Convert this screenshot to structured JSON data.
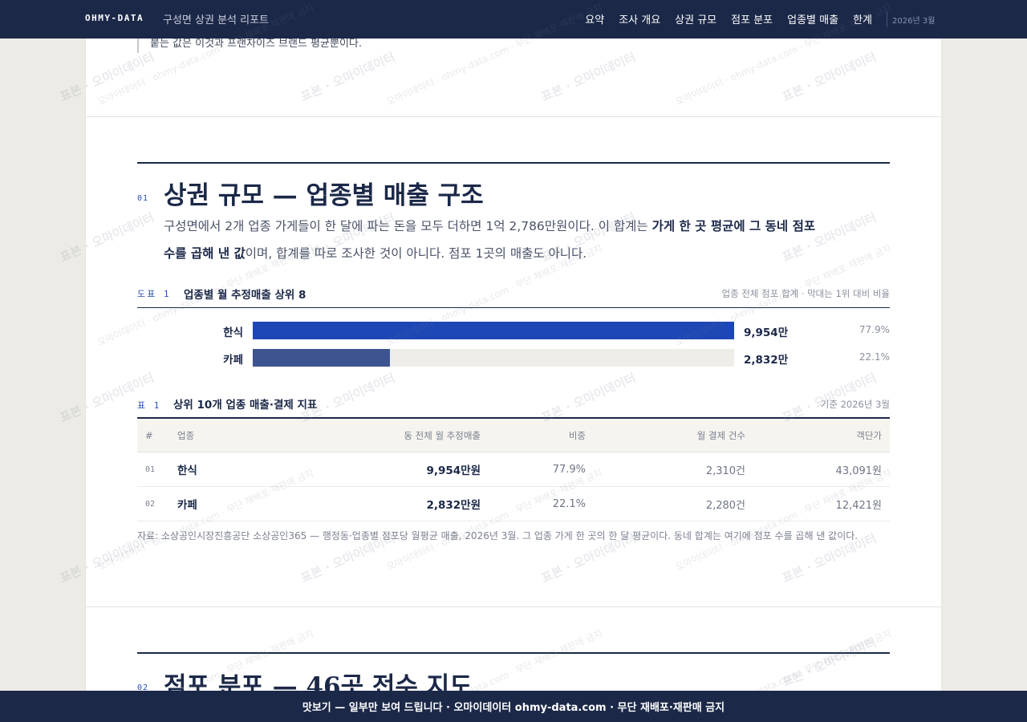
{
  "header": {
    "brand": "OHMY-DATA",
    "report_title": "구성면 상권 분석 리포트",
    "nav": [
      "요약",
      "조사 개요",
      "상권 규모",
      "점포 분포",
      "업종별 매출",
      "한계"
    ],
    "date": "2026년 3월"
  },
  "prev_section": {
    "quote_tail": "붙는 값은 이것과 프랜차이즈 브랜드 평균뿐이다."
  },
  "section1": {
    "number": "01",
    "title": "상권 규모 — 업종별 매출 구조",
    "lead_part1": "구성면에서 2개 업종 가게들이 한 달에 파는 돈을 모두 더하면 1억 2,786만원이다. 이 합계는 ",
    "lead_bold": "가게 한 곳 평균에 그 동네 점포 수를 곱해 낸 값",
    "lead_part2": "이며, 합계를 따로 조사한 것이 아니다. 점포 1곳의 매출도 아니다."
  },
  "figure1": {
    "label": "도표 1",
    "title": "업종별 월 추정매출 상위 8",
    "note": "업종 전체 점포 합계 · 막대는 1위 대비 비율"
  },
  "chart_data": {
    "type": "bar",
    "orientation": "horizontal",
    "title": "업종별 월 추정매출 상위 8",
    "categories": [
      "한식",
      "카페"
    ],
    "values": [
      9954,
      2832
    ],
    "value_labels": [
      "9,954만",
      "2,832만"
    ],
    "share_labels": [
      "77.9%",
      "22.1%"
    ],
    "relative_to_first": [
      1.0,
      0.2845
    ],
    "colors": [
      "#1d47b5",
      "#3d5490"
    ],
    "unit": "만원"
  },
  "table1": {
    "label": "표 1",
    "title": "상위 10개 업종 매출·결제 지표",
    "note": "기준 2026년 3월",
    "columns": [
      "#",
      "업종",
      "동 전체 월 추정매출",
      "비중",
      "월 결제 건수",
      "객단가"
    ],
    "rows": [
      [
        "01",
        "한식",
        "9,954만원",
        "77.9%",
        "2,310건",
        "43,091원"
      ],
      [
        "02",
        "카페",
        "2,832만원",
        "22.1%",
        "2,280건",
        "12,421원"
      ]
    ]
  },
  "source_note": "자료: 소상공인시장진흥공단 소상공인365 — 행정동·업종별 점포당 월평균 매출, 2026년 3월. 그 업종 가게 한 곳의 한 달 평균이다. 동네 합계는 여기에 점포 수를 곱해 낸 값이다.",
  "section2": {
    "number": "02",
    "title": "점포 분포 — 46곳 전수 지도"
  },
  "watermark": {
    "main": "표본 · 오마이데이터",
    "sub": "오마이데이터 · ohmy-data.com · 무단 재배포·재판매 금지"
  },
  "footer": {
    "text": "맛보기 — 일부만 보여 드립니다 · 오마이데이터 ohmy-data.com · 무단 재배포·재판매 금지"
  }
}
